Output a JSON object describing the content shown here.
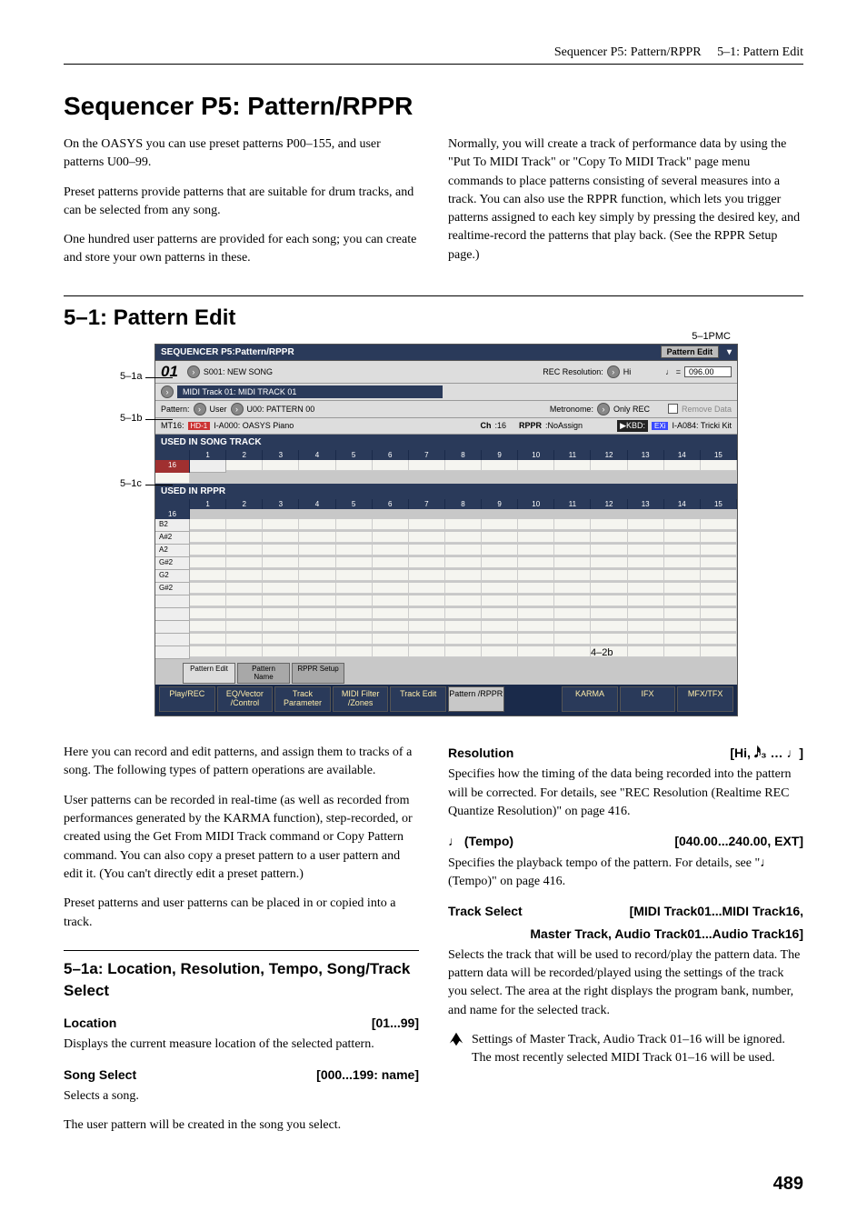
{
  "header": {
    "left": "Sequencer P5: Pattern/RPPR",
    "right": "5–1: Pattern Edit"
  },
  "h1": "Sequencer P5: Pattern/RPPR",
  "intro": {
    "left": [
      "On the OASYS you can use preset patterns P00–155, and user patterns U00–99.",
      "Preset patterns provide patterns that are suitable for drum tracks, and can be selected from any song.",
      "One hundred user patterns are provided for each song; you can create and store your own patterns in these."
    ],
    "right": [
      "Normally, you will create a track of performance data by using the \"Put To MIDI Track\" or \"Copy To MIDI Track\" page menu commands to place patterns consisting of several measures into a track. You can also use the RPPR function, which lets you trigger patterns assigned to each key simply by pressing the desired key, and realtime-record the patterns that play back. (See the RPPR Setup page.)"
    ]
  },
  "h2": "5–1: Pattern Edit",
  "callouts": {
    "a": "5–1a",
    "b": "5–1b",
    "c": "5–1c",
    "pmc": "5–1PMC",
    "r": "4–2b"
  },
  "ss": {
    "title": "SEQUENCER P5:Pattern/RPPR",
    "title_btn": "Pattern Edit",
    "loc": "01",
    "song": "S001: NEW SONG",
    "rec_res_label": "REC Resolution:",
    "rec_res_val": "Hi",
    "tempo_label": "♩ =",
    "tempo_val": "096.00",
    "track": "MIDI Track 01: MIDI TRACK 01",
    "pat_label": "Pattern:",
    "pat_bank": "User",
    "pat_name": "U00: PATTERN 00",
    "metro_label": "Metronome:",
    "metro_val": "Only REC",
    "remove": "Remove Data",
    "mt_label": "MT16:",
    "mt_badge": "HD-1",
    "mt_val": "I-A000: OASYS Piano",
    "ch_label": "Ch",
    "ch_val": ":16",
    "rppr_label": "RPPR",
    "rppr_val": ":NoAssign",
    "kbd_label": "KBD:",
    "kbd_badge": "EXi",
    "kbd_val": "I-A084: Tricki Kit",
    "band1": "USED IN SONG TRACK",
    "band2": "USED IN RPPR",
    "notes": [
      "B2",
      "A#2",
      "A2",
      "G#2",
      "G2",
      "G#2"
    ],
    "cols": [
      "1",
      "2",
      "3",
      "4",
      "5",
      "6",
      "7",
      "8",
      "9",
      "10",
      "11",
      "12",
      "13",
      "14",
      "15",
      "16"
    ],
    "tabs_top": [
      "Pattern Edit",
      "Pattern Name",
      "RPPR Setup"
    ],
    "tabs_bot": [
      "Play/REC",
      "EQ/Vector /Control",
      "Track Parameter",
      "MIDI Filter /Zones",
      "Track Edit",
      "Pattern /RPPR",
      "",
      "KARMA",
      "IFX",
      "MFX/TFX"
    ]
  },
  "body": {
    "left": {
      "p1": "Here you can record and edit patterns, and assign them to tracks of a song. The following types of pattern operations are available.",
      "p2": "User patterns can be recorded in real-time (as well as recorded from performances generated by the KARMA function), step-recorded, or created using the Get From MIDI Track command or Copy Pattern command. You can also copy a preset pattern to a user pattern and edit it. (You can't directly edit a preset pattern.)",
      "p3": "Preset patterns and user patterns can be placed in or copied into a track.",
      "h3": "5–1a: Location, Resolution, Tempo, Song/Track Select",
      "loc_name": "Location",
      "loc_range": "[01...99]",
      "loc_desc": "Displays the current measure location of the selected pattern.",
      "song_name": "Song Select",
      "song_range": "[000...199: name]",
      "song_desc1": "Selects a song.",
      "song_desc2": "The user pattern will be created in the song you select."
    },
    "right": {
      "res_name": "Resolution",
      "res_range": "[Hi, 𝅘𝅥𝅰₃ … ♩]",
      "res_desc": "Specifies how the timing of the data being recorded into the pattern will be corrected. For details, see \"REC Resolution (Realtime REC Quantize Resolution)\" on page 416.",
      "tempo_name": "♩ (Tempo)",
      "tempo_range": "[040.00...240.00, EXT]",
      "tempo_desc": "Specifies the playback tempo of the pattern. For details, see \"♩ (Tempo)\" on page 416.",
      "tsel_name": "Track Select",
      "tsel_range": "[MIDI Track01...MIDI Track16,",
      "tsel_range2": "Master Track, Audio Track01...Audio Track16]",
      "tsel_desc": "Selects the track that will be used to record/play the pattern data. The pattern data will be recorded/played using the settings of the track you select. The area at the right displays the program bank, number, and name for the selected track.",
      "tsel_note": "Settings of Master Track, Audio Track 01–16 will be ignored. The most recently selected MIDI Track 01–16 will be used."
    }
  },
  "pagenum": "489"
}
